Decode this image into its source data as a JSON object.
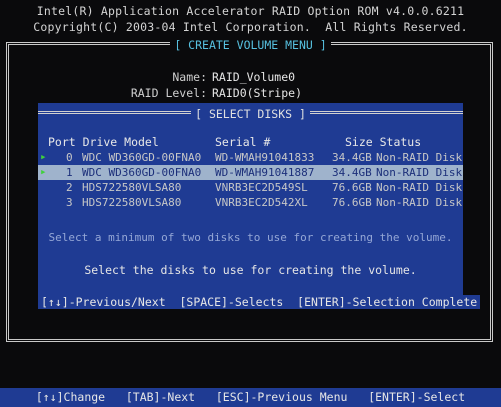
{
  "header": {
    "line1": "Intel(R) Application Accelerator RAID Option ROM v4.0.0.6211",
    "line2": "Copyright(C) 2003-04 Intel Corporation.  All Rights Reserved."
  },
  "create_menu": {
    "title": "[ CREATE VOLUME MENU ]",
    "name_label": "Name:",
    "name_value": "RAID_Volume0",
    "raid_level_label": "RAID Level:",
    "raid_level_value": "RAID0(Stripe)"
  },
  "select_disks": {
    "title": "[ SELECT DISKS ]",
    "columns": {
      "port_drive_model": "Port Drive Model",
      "serial": "Serial #",
      "size_status": "Size Status"
    },
    "disks": [
      {
        "marker": "▸",
        "port": "0",
        "model": "WDC WD360GD-00FNA0",
        "serial": "WD-WMAH91041833",
        "size": "34.4GB",
        "status": "Non-RAID Disk"
      },
      {
        "marker": "▸",
        "port": "1",
        "model": "WDC WD360GD-00FNA0",
        "serial": "WD-WMAH91041887",
        "size": "34.4GB",
        "status": "Non-RAID Disk"
      },
      {
        "marker": "",
        "port": "2",
        "model": "HDS722580VLSA80",
        "serial": "VNRB3EC2D549SL",
        "size": "76.6GB",
        "status": "Non-RAID Disk"
      },
      {
        "marker": "",
        "port": "3",
        "model": "HDS722580VLSA80",
        "serial": "VNRB3EC2D542XL",
        "size": "76.6GB",
        "status": "Non-RAID Disk"
      }
    ],
    "selected_index": 1,
    "hint_min": "Select a minimum of two disks to use for creating the volume.",
    "hint_main": "Select the disks to use for creating the volume.",
    "keys": "[↑↓]-Previous/Next  [SPACE]-Selects  [ENTER]-Selection Complete"
  },
  "bottom_bar": "[↑↓]Change   [TAB]-Next   [ESC]-Previous Menu   [ENTER]-Select",
  "colors": {
    "panel_blue": "#1f3b93",
    "selection": "#9fb3cc",
    "marker_green": "#3fd23a",
    "title_cyan": "#57c1e0"
  }
}
